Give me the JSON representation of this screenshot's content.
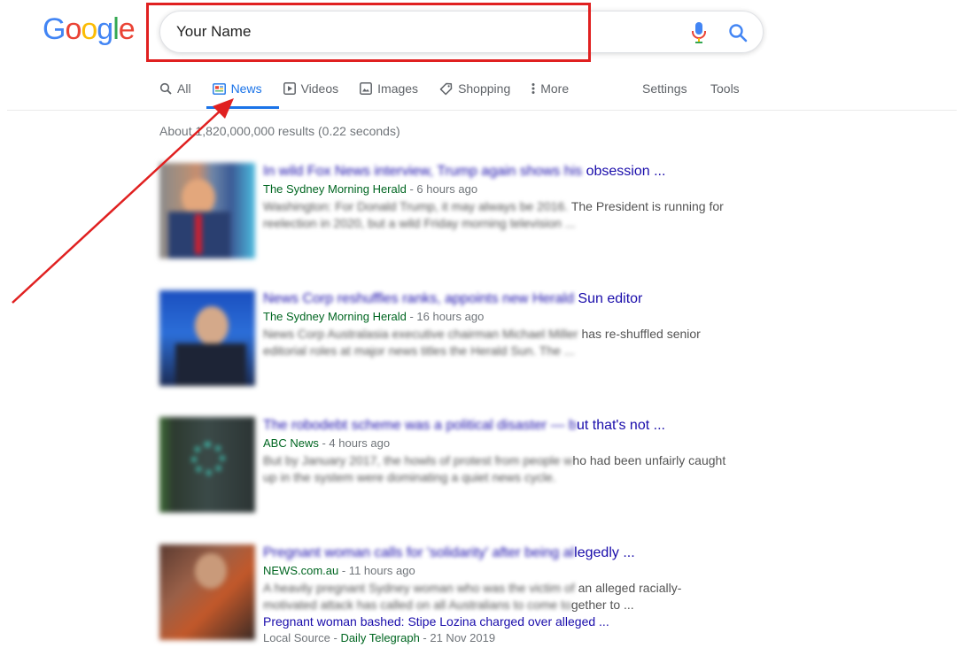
{
  "logo": {
    "letters": [
      "G",
      "o",
      "o",
      "g",
      "l",
      "e"
    ],
    "colors": [
      "#4285F4",
      "#EA4335",
      "#FBBC05",
      "#4285F4",
      "#34A853",
      "#EA4335"
    ]
  },
  "search": {
    "value": "Your Name",
    "mic_icon": "mic-icon",
    "search_icon": "search-icon"
  },
  "tabs": [
    {
      "label": "All",
      "icon": "search-icon"
    },
    {
      "label": "News",
      "icon": "news-icon",
      "active": true
    },
    {
      "label": "Videos",
      "icon": "play-icon"
    },
    {
      "label": "Images",
      "icon": "image-icon"
    },
    {
      "label": "Shopping",
      "icon": "tag-icon"
    },
    {
      "label": "More",
      "icon": "more-vert-icon"
    }
  ],
  "tools": {
    "settings": "Settings",
    "tools": "Tools"
  },
  "result_stats": {
    "visible": "About 1,820,000,000 results (0.22 seconds)"
  },
  "results": [
    {
      "title_blur": "In wild Fox News interview, Trump again shows his",
      "title_clear": " obsession ...",
      "source": "The Sydney Morning Herald",
      "age": " - 6 hours ago",
      "snippet1_blur": "Washington: For Donald Trump, it may always be 2016.",
      "snippet1_clear": " The President is running for",
      "snippet2_blur": "reelection in 2020, but a wild Friday morning television ..."
    },
    {
      "title_blur": "News Corp reshuffles ranks, appoints new Herald",
      "title_clear": " Sun editor",
      "source": "The Sydney Morning Herald",
      "age": " - 16 hours ago",
      "snippet1_blur": "News Corp Australasia executive chairman Michael Miller",
      "snippet1_clear": " has re-shuffled senior",
      "snippet2_blur": "editorial roles at major news titles the Herald Sun. The ..."
    },
    {
      "title_blur": "The robodebt scheme was a political disaster — b",
      "title_clear": "ut that's not ...",
      "source": "ABC News",
      "age": " - 4 hours ago",
      "snippet1_blur": "But by January 2017, the howls of protest from people w",
      "snippet1_clear": "ho had been unfairly caught",
      "snippet2_blur": "up in the system were dominating a quiet news cycle."
    },
    {
      "title_blur": "Pregnant woman calls for 'solidarity' after being al",
      "title_clear": "legedly ...",
      "source": "NEWS.com.au",
      "age": " - 11 hours ago",
      "snippet1_blur": "A heavily pregnant Sydney woman who was the victim of",
      "snippet1_clear": " an alleged racially-",
      "snippet2_blur": "motivated attack has called on all Australians to come to",
      "snippet2_clear": "gether to ...",
      "sub_blur": "Pregnant woman bashed: Stipe Lozina charged over alle",
      "sub_clear": "ged ...",
      "local_prefix": "Local Source - ",
      "local_source": "Daily Telegraph",
      "local_date": " - 21 Nov 2019"
    }
  ],
  "annotation": {
    "arrow_color": "#e02020",
    "box_color": "#e02020"
  }
}
